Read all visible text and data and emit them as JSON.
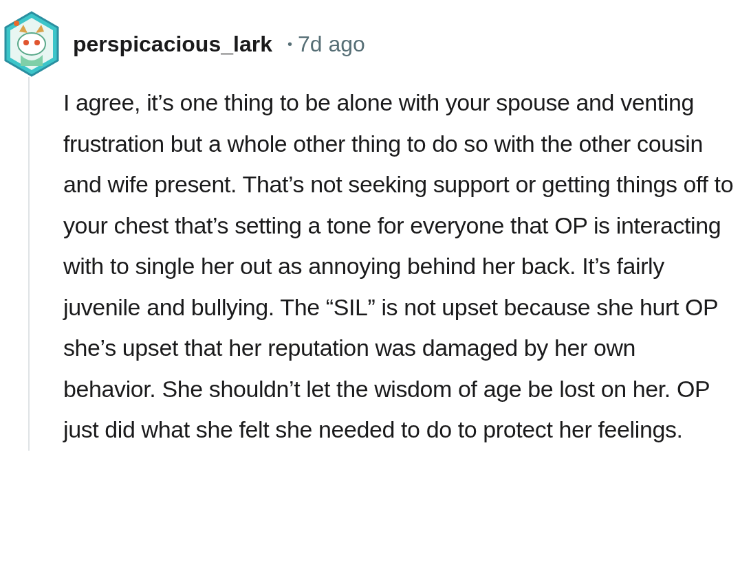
{
  "comment": {
    "author": "perspicacious_lark",
    "separator": "•",
    "time": "7d ago",
    "body": "I agree, it’s one thing to be alone with your spouse and venting frustration but a whole other thing to do so with the other cousin and wife present. That’s not seeking support or getting things off to your chest that’s setting a tone for everyone that OP is interacting with to single her out as annoying behind her back. It’s fairly juvenile and bullying. The “SIL” is not upset because she hurt OP she’s upset that her reputation was damaged by her own behavior. She shouldn’t let the wisdom of age be lost on her. OP just did what she felt she needed to do to protect her feelings."
  }
}
